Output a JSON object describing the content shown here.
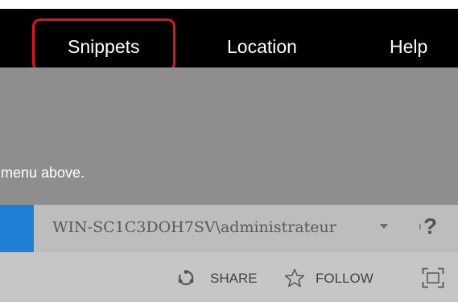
{
  "menu": {
    "items": [
      {
        "label": "Snippets"
      },
      {
        "label": "Location"
      },
      {
        "label": "Help"
      }
    ]
  },
  "hint": {
    "text": "menu above."
  },
  "user": {
    "name": "WIN-SC1C3DOH7SV\\administrateur",
    "help_glyph": "?"
  },
  "actions": {
    "share_label": "SHARE",
    "follow_label": "FOLLOW"
  },
  "colors": {
    "menu_bg": "#000000",
    "highlight": "#e11414",
    "accent": "#1f7fd4",
    "hint_panel": "#8e8e8e"
  },
  "icons": {
    "share": "share-icon",
    "follow": "star-icon",
    "focus": "focus-mode-icon",
    "help": "help-icon",
    "user_menu": "chevron-down-icon"
  }
}
